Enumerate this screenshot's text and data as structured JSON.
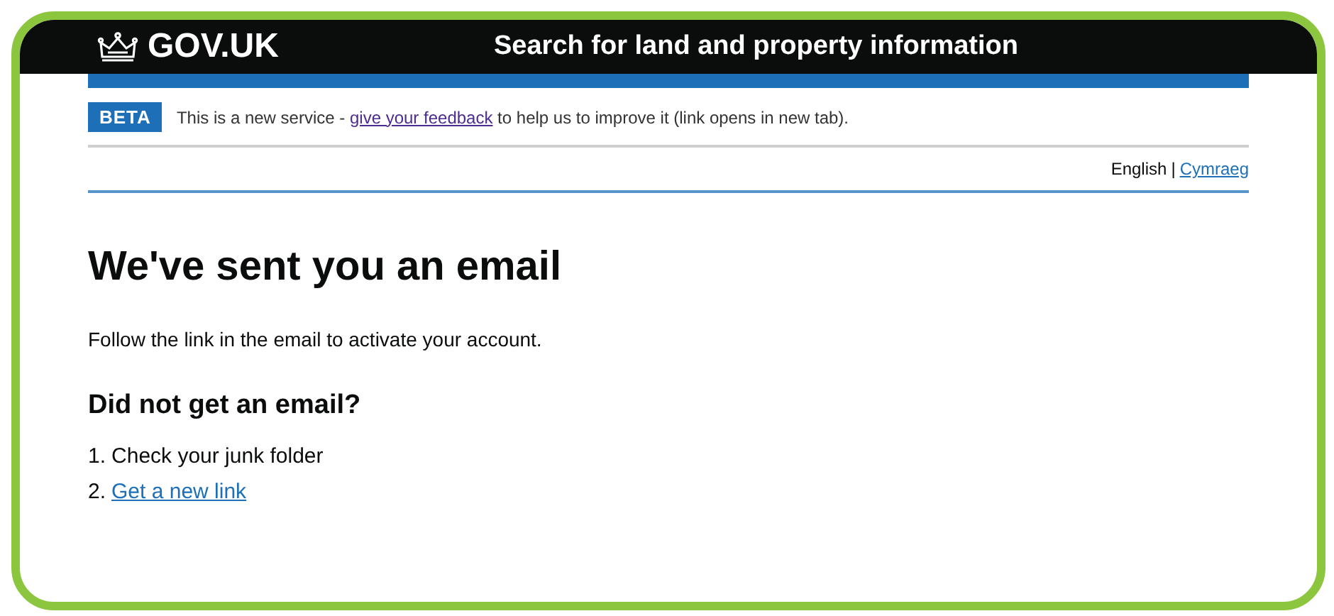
{
  "header": {
    "logo": "GOV.UK",
    "service_name": "Search for land and property information"
  },
  "phase_banner": {
    "tag": "BETA",
    "text_before": "This is a new service - ",
    "link": "give your feedback",
    "text_after": " to help us to improve it (link opens in new tab)."
  },
  "language_switcher": {
    "separator": "|",
    "languages": [
      {
        "label": "English",
        "selected": true
      },
      {
        "label": "Cymraeg",
        "selected": false
      }
    ]
  },
  "heading": "We've sent you an email",
  "body": "Follow the link in the email to activate your account.",
  "subheading": "Did not get an email?",
  "steps": [
    {
      "number": "1.",
      "text": "Check your junk folder",
      "kind": "text"
    },
    {
      "number": "2.",
      "text": "Get a new link",
      "kind": "link"
    }
  ]
}
